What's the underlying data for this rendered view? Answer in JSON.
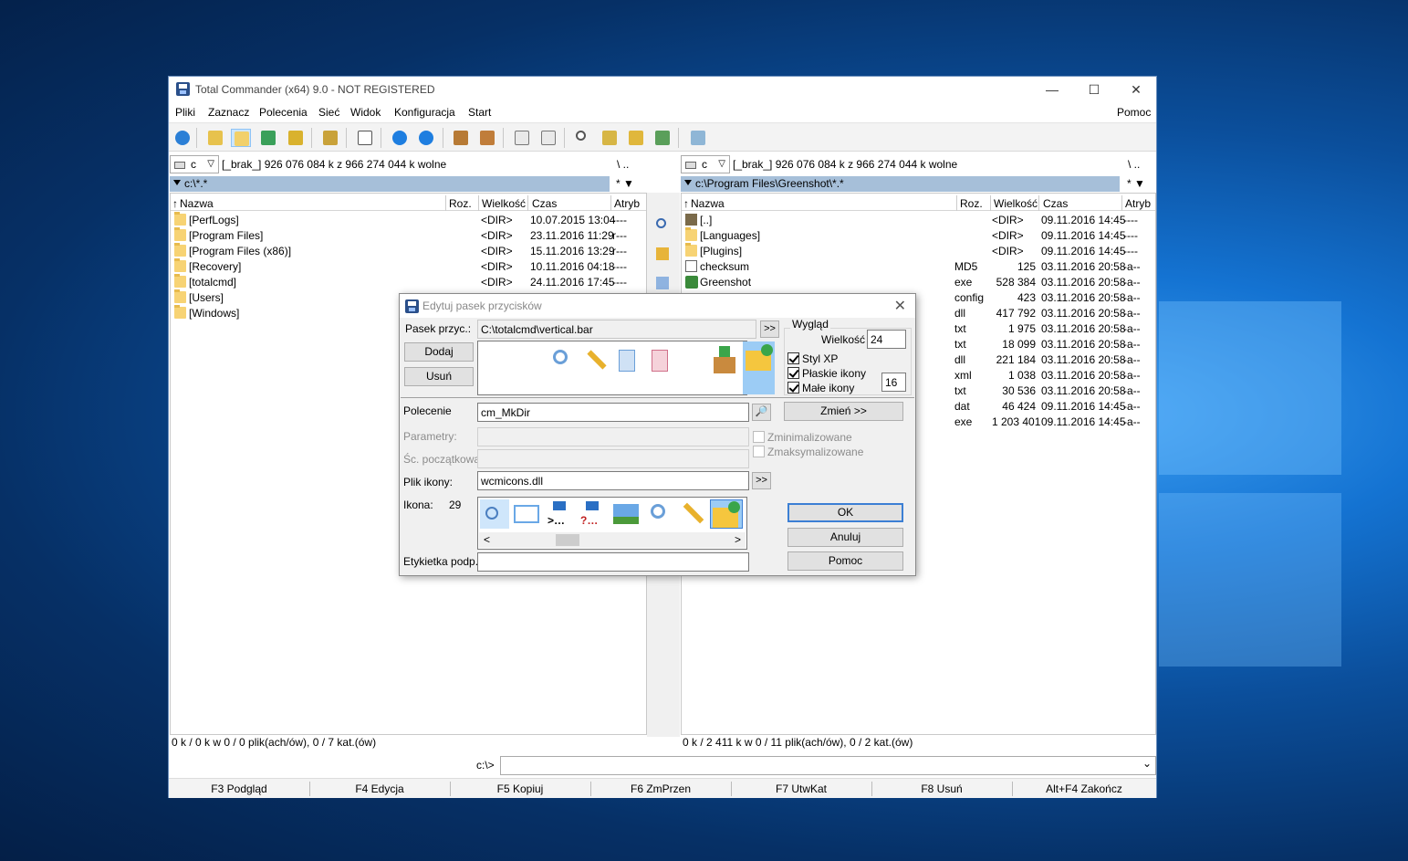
{
  "window": {
    "title": "Total Commander (x64) 9.0 - NOT REGISTERED",
    "minimize": "—",
    "maximize": "☐",
    "close": "✕"
  },
  "menu": [
    "Pliki",
    "Zaznacz",
    "Polecenia",
    "Sieć",
    "Widok",
    "Konfiguracja",
    "Start"
  ],
  "menu_help": "Pomoc",
  "left": {
    "drive": "c",
    "drive_arrow": "▽",
    "free": "[_brak_]  926 076 084 k z 966 274 044 k wolne",
    "root_up": "\\   ..",
    "path": "c:\\*.*",
    "star": "*  ▼",
    "columns": {
      "name": "Nazwa",
      "ext": "Roz.",
      "size": "Wielkość",
      "date": "Czas",
      "attr": "Atryb"
    },
    "rows": [
      {
        "name": "[PerfLogs]",
        "size": "<DIR>",
        "date": "10.07.2015 13:04",
        "attr": "----"
      },
      {
        "name": "[Program Files]",
        "size": "<DIR>",
        "date": "23.11.2016 11:29",
        "attr": "r---"
      },
      {
        "name": "[Program Files (x86)]",
        "size": "<DIR>",
        "date": "15.11.2016 13:29",
        "attr": "r---"
      },
      {
        "name": "[Recovery]",
        "size": "<DIR>",
        "date": "10.11.2016 04:18",
        "attr": "----"
      },
      {
        "name": "[totalcmd]",
        "size": "<DIR>",
        "date": "24.11.2016 17:45",
        "attr": "----"
      },
      {
        "name": "[Users]",
        "size": "",
        "date": "",
        "attr": ""
      },
      {
        "name": "[Windows]",
        "size": "",
        "date": "",
        "attr": ""
      }
    ],
    "status": "0 k / 0 k w 0 / 0 plik(ach/ów), 0 / 7 kat.(ów)"
  },
  "right": {
    "drive": "c",
    "drive_arrow": "▽",
    "free": "[_brak_]  926 076 084 k z 966 274 044 k wolne",
    "root_up": "\\   ..",
    "path": "c:\\Program Files\\Greenshot\\*.*",
    "star": "*  ▼",
    "columns": {
      "name": "Nazwa",
      "ext": "Roz.",
      "size": "Wielkość",
      "date": "Czas",
      "attr": "Atryb"
    },
    "rows": [
      {
        "name": "[..]",
        "ext": "",
        "size": "<DIR>",
        "date": "09.11.2016 14:45",
        "attr": "----",
        "icon": "up"
      },
      {
        "name": "[Languages]",
        "ext": "",
        "size": "<DIR>",
        "date": "09.11.2016 14:45",
        "attr": "----",
        "icon": "folder"
      },
      {
        "name": "[Plugins]",
        "ext": "",
        "size": "<DIR>",
        "date": "09.11.2016 14:45",
        "attr": "----",
        "icon": "folder"
      },
      {
        "name": "checksum",
        "ext": "MD5",
        "size": "125",
        "date": "03.11.2016 20:58",
        "attr": "-a--",
        "icon": "file"
      },
      {
        "name": "Greenshot",
        "ext": "exe",
        "size": "528 384",
        "date": "03.11.2016 20:58",
        "attr": "-a--",
        "icon": "exe"
      },
      {
        "name": "",
        "ext": "config",
        "size": "423",
        "date": "03.11.2016 20:58",
        "attr": "-a--",
        "icon": "none"
      },
      {
        "name": "",
        "ext": "dll",
        "size": "417 792",
        "date": "03.11.2016 20:58",
        "attr": "-a--",
        "icon": "none"
      },
      {
        "name": "",
        "ext": "txt",
        "size": "1 975",
        "date": "03.11.2016 20:58",
        "attr": "-a--",
        "icon": "none"
      },
      {
        "name": "",
        "ext": "txt",
        "size": "18 099",
        "date": "03.11.2016 20:58",
        "attr": "-a--",
        "icon": "none"
      },
      {
        "name": "",
        "ext": "dll",
        "size": "221 184",
        "date": "03.11.2016 20:58",
        "attr": "-a--",
        "icon": "none"
      },
      {
        "name": "",
        "ext": "xml",
        "size": "1 038",
        "date": "03.11.2016 20:58",
        "attr": "-a--",
        "icon": "none"
      },
      {
        "name": "",
        "ext": "txt",
        "size": "30 536",
        "date": "03.11.2016 20:58",
        "attr": "-a--",
        "icon": "none"
      },
      {
        "name": "",
        "ext": "dat",
        "size": "46 424",
        "date": "09.11.2016 14:45",
        "attr": "-a--",
        "icon": "none"
      },
      {
        "name": "",
        "ext": "exe",
        "size": "1 203 401",
        "date": "09.11.2016 14:45",
        "attr": "-a--",
        "icon": "none"
      }
    ],
    "status": "0 k / 2 411 k w 0 / 11 plik(ach/ów), 0 / 2 kat.(ów)"
  },
  "cmd": {
    "prompt": "c:\\>",
    "arrow": "⌄"
  },
  "fkeys": [
    "F3 Podgląd",
    "F4 Edycja",
    "F5 Kopiuj",
    "F6 ZmPrzen",
    "F7 UtwKat",
    "F8 Usuń",
    "Alt+F4 Zakończ"
  ],
  "dialog": {
    "title": "Edytuj pasek przycisków",
    "close": "✕",
    "bar_label": "Pasek przyc.:",
    "bar_value": "C:\\totalcmd\\vertical.bar",
    "browse": ">>",
    "add": "Dodaj",
    "remove": "Usuń",
    "look_group": "Wygląd",
    "size_label": "Wielkość",
    "size_value": "24",
    "xp_style": "Styl XP",
    "flat_icons": "Płaskie ikony",
    "small_icons": "Małe ikony",
    "small_value": "16",
    "command_label": "Polecenie",
    "command_value": "cm_MkDir",
    "search_glyph": "🔎",
    "change": "Zmień >>",
    "params_label": "Parametry:",
    "start_label": "Śc. początkowa:",
    "minimized": "Zminimalizowane",
    "maximized": "Zmaksymalizowane",
    "icon_file_label": "Plik ikony:",
    "icon_file_value": "wcmicons.dll",
    "icon_label": "Ikona:",
    "icon_index": "29",
    "scroll_left": "<",
    "scroll_right": ">",
    "tooltip_label": "Etykietka podp.:",
    "ok": "OK",
    "cancel": "Anuluj",
    "help": "Pomoc"
  },
  "colors": {
    "accent": "#3c7fd4",
    "path_bar": "#a6bfd9",
    "folder": "#f7d374"
  }
}
